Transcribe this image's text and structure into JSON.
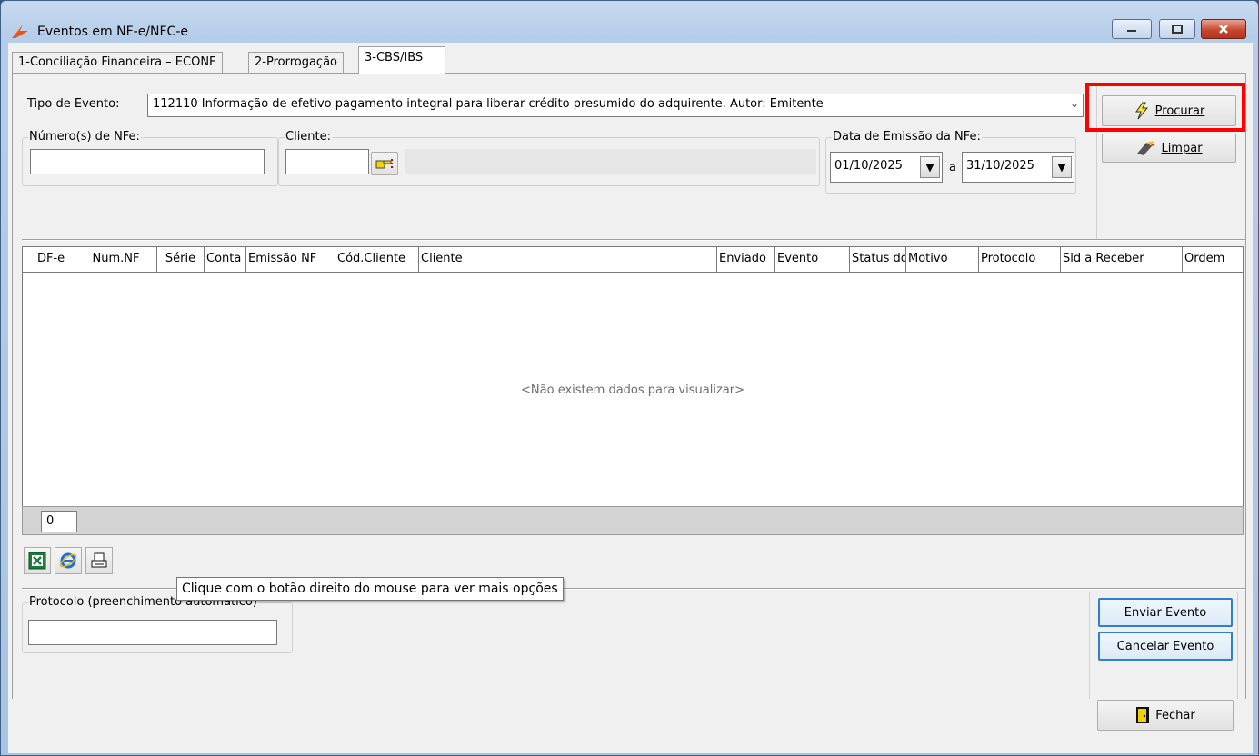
{
  "window": {
    "title": "Eventos em NF-e/NFC-e",
    "controls": {
      "minimize": "minimize",
      "maximize": "maximize",
      "close": "close"
    }
  },
  "tabs": [
    {
      "label": "1-Conciliação Financeira – ECONF",
      "active": false
    },
    {
      "label": "2-Prorrogação",
      "active": false
    },
    {
      "label": "3-CBS/IBS",
      "active": true
    }
  ],
  "filters": {
    "tipo_evento_label": "Tipo de Evento:",
    "tipo_evento_value": "112110 Informação de efetivo pagamento integral para liberar crédito presumido do adquirente. Autor: Emitente",
    "numero_nfe_label": "Número(s) de NFe:",
    "numero_nfe_value": "",
    "cliente_label": "Cliente:",
    "cliente_code": "",
    "cliente_name": "",
    "data_emissao_label": "Data de Emissão da NFe:",
    "data_from": "01/10/2025",
    "data_sep": "a",
    "data_to": "31/10/2025"
  },
  "actions": {
    "procurar": "Procurar",
    "limpar": "Limpar",
    "enviar_evento": "Enviar Evento",
    "cancelar_evento": "Cancelar Evento",
    "fechar": "Fechar"
  },
  "grid": {
    "columns": [
      "DF-e",
      "Num.NF",
      "Série",
      "Conta",
      "Emissão NF",
      "Cód.Cliente",
      "Cliente",
      "Enviado",
      "Evento",
      "Status do",
      "Motivo",
      "Protocolo",
      "Sld a Receber",
      "Ordem"
    ],
    "empty_message": "<Não existem dados para visualizar>",
    "row_count": "0"
  },
  "toolbar_icons": [
    "excel-icon",
    "internet-explorer-icon",
    "printer-icon"
  ],
  "tooltip": "Clique com o botão direito do mouse para ver mais opções",
  "protocolo": {
    "label": "Protocolo (preenchimento automático)",
    "value": ""
  },
  "colors": {
    "highlight": "#ff0000",
    "focus_border": "#2e7fcf",
    "close_button": "#c6422c"
  }
}
